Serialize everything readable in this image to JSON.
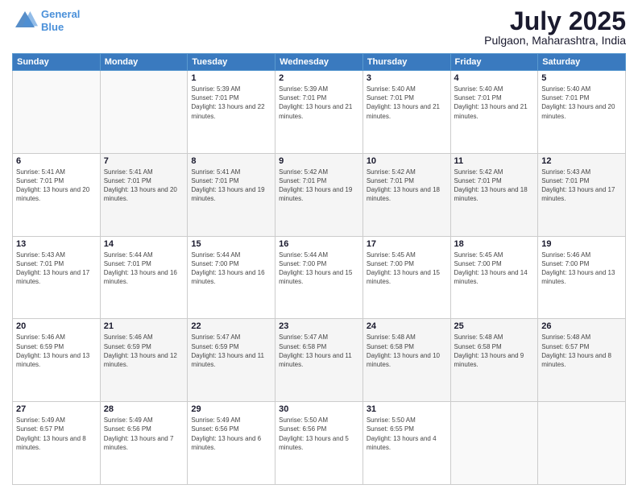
{
  "logo": {
    "line1": "General",
    "line2": "Blue"
  },
  "title": {
    "month": "July 2025",
    "location": "Pulgaon, Maharashtra, India"
  },
  "headers": [
    "Sunday",
    "Monday",
    "Tuesday",
    "Wednesday",
    "Thursday",
    "Friday",
    "Saturday"
  ],
  "weeks": [
    [
      {
        "day": "",
        "sunrise": "",
        "sunset": "",
        "daylight": ""
      },
      {
        "day": "",
        "sunrise": "",
        "sunset": "",
        "daylight": ""
      },
      {
        "day": "1",
        "sunrise": "Sunrise: 5:39 AM",
        "sunset": "Sunset: 7:01 PM",
        "daylight": "Daylight: 13 hours and 22 minutes."
      },
      {
        "day": "2",
        "sunrise": "Sunrise: 5:39 AM",
        "sunset": "Sunset: 7:01 PM",
        "daylight": "Daylight: 13 hours and 21 minutes."
      },
      {
        "day": "3",
        "sunrise": "Sunrise: 5:40 AM",
        "sunset": "Sunset: 7:01 PM",
        "daylight": "Daylight: 13 hours and 21 minutes."
      },
      {
        "day": "4",
        "sunrise": "Sunrise: 5:40 AM",
        "sunset": "Sunset: 7:01 PM",
        "daylight": "Daylight: 13 hours and 21 minutes."
      },
      {
        "day": "5",
        "sunrise": "Sunrise: 5:40 AM",
        "sunset": "Sunset: 7:01 PM",
        "daylight": "Daylight: 13 hours and 20 minutes."
      }
    ],
    [
      {
        "day": "6",
        "sunrise": "Sunrise: 5:41 AM",
        "sunset": "Sunset: 7:01 PM",
        "daylight": "Daylight: 13 hours and 20 minutes."
      },
      {
        "day": "7",
        "sunrise": "Sunrise: 5:41 AM",
        "sunset": "Sunset: 7:01 PM",
        "daylight": "Daylight: 13 hours and 20 minutes."
      },
      {
        "day": "8",
        "sunrise": "Sunrise: 5:41 AM",
        "sunset": "Sunset: 7:01 PM",
        "daylight": "Daylight: 13 hours and 19 minutes."
      },
      {
        "day": "9",
        "sunrise": "Sunrise: 5:42 AM",
        "sunset": "Sunset: 7:01 PM",
        "daylight": "Daylight: 13 hours and 19 minutes."
      },
      {
        "day": "10",
        "sunrise": "Sunrise: 5:42 AM",
        "sunset": "Sunset: 7:01 PM",
        "daylight": "Daylight: 13 hours and 18 minutes."
      },
      {
        "day": "11",
        "sunrise": "Sunrise: 5:42 AM",
        "sunset": "Sunset: 7:01 PM",
        "daylight": "Daylight: 13 hours and 18 minutes."
      },
      {
        "day": "12",
        "sunrise": "Sunrise: 5:43 AM",
        "sunset": "Sunset: 7:01 PM",
        "daylight": "Daylight: 13 hours and 17 minutes."
      }
    ],
    [
      {
        "day": "13",
        "sunrise": "Sunrise: 5:43 AM",
        "sunset": "Sunset: 7:01 PM",
        "daylight": "Daylight: 13 hours and 17 minutes."
      },
      {
        "day": "14",
        "sunrise": "Sunrise: 5:44 AM",
        "sunset": "Sunset: 7:01 PM",
        "daylight": "Daylight: 13 hours and 16 minutes."
      },
      {
        "day": "15",
        "sunrise": "Sunrise: 5:44 AM",
        "sunset": "Sunset: 7:00 PM",
        "daylight": "Daylight: 13 hours and 16 minutes."
      },
      {
        "day": "16",
        "sunrise": "Sunrise: 5:44 AM",
        "sunset": "Sunset: 7:00 PM",
        "daylight": "Daylight: 13 hours and 15 minutes."
      },
      {
        "day": "17",
        "sunrise": "Sunrise: 5:45 AM",
        "sunset": "Sunset: 7:00 PM",
        "daylight": "Daylight: 13 hours and 15 minutes."
      },
      {
        "day": "18",
        "sunrise": "Sunrise: 5:45 AM",
        "sunset": "Sunset: 7:00 PM",
        "daylight": "Daylight: 13 hours and 14 minutes."
      },
      {
        "day": "19",
        "sunrise": "Sunrise: 5:46 AM",
        "sunset": "Sunset: 7:00 PM",
        "daylight": "Daylight: 13 hours and 13 minutes."
      }
    ],
    [
      {
        "day": "20",
        "sunrise": "Sunrise: 5:46 AM",
        "sunset": "Sunset: 6:59 PM",
        "daylight": "Daylight: 13 hours and 13 minutes."
      },
      {
        "day": "21",
        "sunrise": "Sunrise: 5:46 AM",
        "sunset": "Sunset: 6:59 PM",
        "daylight": "Daylight: 13 hours and 12 minutes."
      },
      {
        "day": "22",
        "sunrise": "Sunrise: 5:47 AM",
        "sunset": "Sunset: 6:59 PM",
        "daylight": "Daylight: 13 hours and 11 minutes."
      },
      {
        "day": "23",
        "sunrise": "Sunrise: 5:47 AM",
        "sunset": "Sunset: 6:58 PM",
        "daylight": "Daylight: 13 hours and 11 minutes."
      },
      {
        "day": "24",
        "sunrise": "Sunrise: 5:48 AM",
        "sunset": "Sunset: 6:58 PM",
        "daylight": "Daylight: 13 hours and 10 minutes."
      },
      {
        "day": "25",
        "sunrise": "Sunrise: 5:48 AM",
        "sunset": "Sunset: 6:58 PM",
        "daylight": "Daylight: 13 hours and 9 minutes."
      },
      {
        "day": "26",
        "sunrise": "Sunrise: 5:48 AM",
        "sunset": "Sunset: 6:57 PM",
        "daylight": "Daylight: 13 hours and 8 minutes."
      }
    ],
    [
      {
        "day": "27",
        "sunrise": "Sunrise: 5:49 AM",
        "sunset": "Sunset: 6:57 PM",
        "daylight": "Daylight: 13 hours and 8 minutes."
      },
      {
        "day": "28",
        "sunrise": "Sunrise: 5:49 AM",
        "sunset": "Sunset: 6:56 PM",
        "daylight": "Daylight: 13 hours and 7 minutes."
      },
      {
        "day": "29",
        "sunrise": "Sunrise: 5:49 AM",
        "sunset": "Sunset: 6:56 PM",
        "daylight": "Daylight: 13 hours and 6 minutes."
      },
      {
        "day": "30",
        "sunrise": "Sunrise: 5:50 AM",
        "sunset": "Sunset: 6:56 PM",
        "daylight": "Daylight: 13 hours and 5 minutes."
      },
      {
        "day": "31",
        "sunrise": "Sunrise: 5:50 AM",
        "sunset": "Sunset: 6:55 PM",
        "daylight": "Daylight: 13 hours and 4 minutes."
      },
      {
        "day": "",
        "sunrise": "",
        "sunset": "",
        "daylight": ""
      },
      {
        "day": "",
        "sunrise": "",
        "sunset": "",
        "daylight": ""
      }
    ]
  ]
}
